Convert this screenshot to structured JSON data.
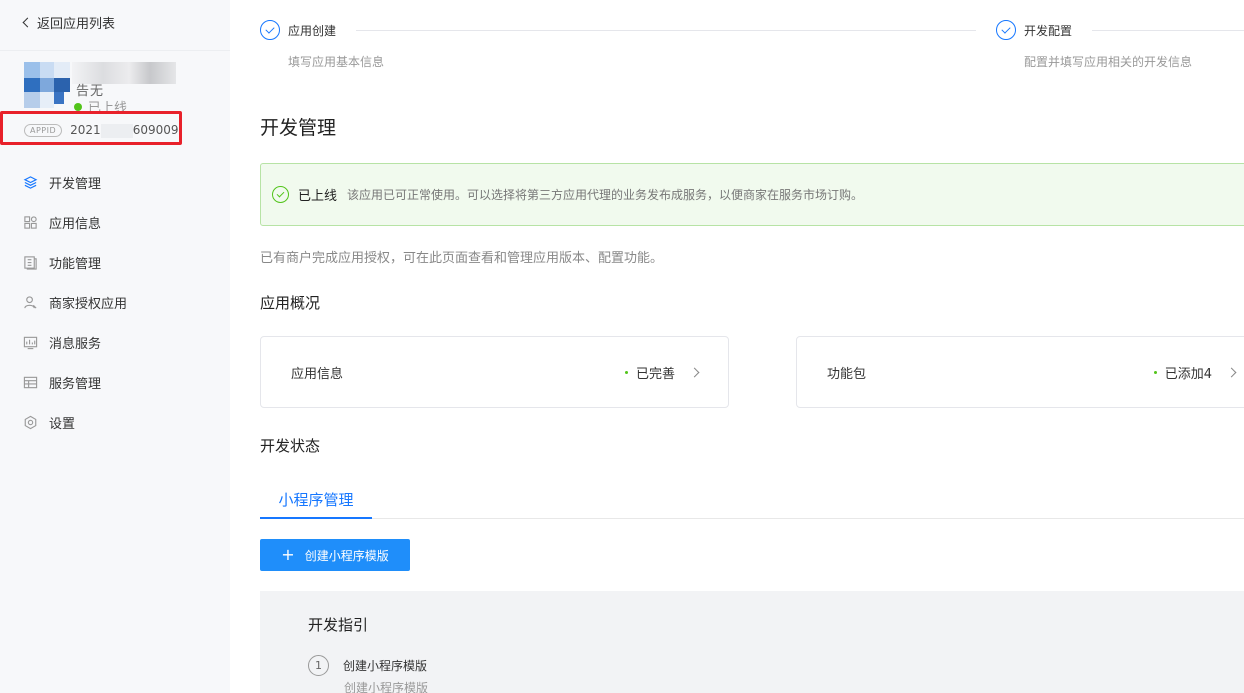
{
  "sidebar": {
    "back_label": "返回应用列表",
    "app_status": "已上线",
    "app_name_fragment": "告无",
    "appid_tag": "APPID",
    "appid_prefix": "2021",
    "appid_suffix": "609009",
    "items": [
      {
        "label": "开发管理",
        "icon": "layers-icon"
      },
      {
        "label": "应用信息",
        "icon": "apps-grid-icon"
      },
      {
        "label": "功能管理",
        "icon": "document-list-icon"
      },
      {
        "label": "商家授权应用",
        "icon": "user-icon"
      },
      {
        "label": "消息服务",
        "icon": "chart-monitor-icon"
      },
      {
        "label": "服务管理",
        "icon": "table-icon"
      },
      {
        "label": "设置",
        "icon": "gear-icon"
      }
    ]
  },
  "steps": [
    {
      "title": "应用创建",
      "desc": "填写应用基本信息"
    },
    {
      "title": "开发配置",
      "desc": "配置并填写应用相关的开发信息"
    }
  ],
  "main": {
    "title": "开发管理",
    "alert": {
      "title": "已上线",
      "text": "该应用已可正常使用。可以选择将第三方应用代理的业务发布成服务，以便商家在服务市场订购。"
    },
    "description": "已有商户完成应用授权，可在此页面查看和管理应用版本、配置功能。",
    "overview_title": "应用概况",
    "cards": [
      {
        "label": "应用信息",
        "status": "已完善"
      },
      {
        "label": "功能包",
        "status": "已添加4"
      }
    ],
    "dev_status_title": "开发状态",
    "tab_label": "小程序管理",
    "create_button": "创建小程序模版",
    "guide": {
      "title": "开发指引",
      "step_num": "1",
      "step_title": "创建小程序模版",
      "step_desc": "创建小程序模版"
    }
  },
  "colors": {
    "accent": "#1677ff",
    "button": "#1f8efa",
    "success": "#52c41a",
    "highlight_box": "#e8212a"
  }
}
